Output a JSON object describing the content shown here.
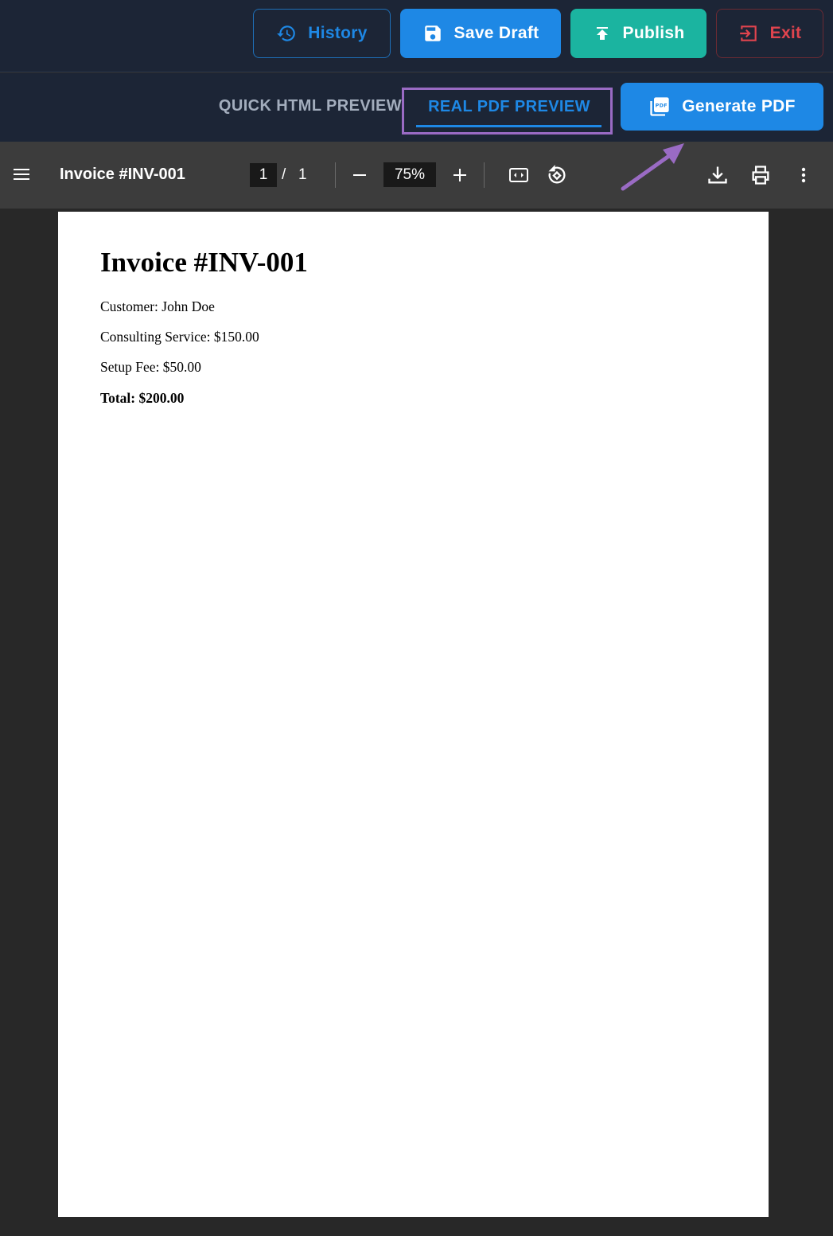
{
  "toolbar": {
    "history_label": "History",
    "save_draft_label": "Save Draft",
    "publish_label": "Publish",
    "exit_label": "Exit"
  },
  "tabs": {
    "quick_html_label": "QUICK HTML PREVIEW",
    "real_pdf_label": "REAL PDF PREVIEW",
    "active": "REAL PDF PREVIEW"
  },
  "generate_pdf_label": "Generate PDF",
  "pdf_viewer": {
    "title": "Invoice #INV-001",
    "current_page": "1",
    "page_separator": "/",
    "total_pages": "1",
    "zoom": "75%"
  },
  "document": {
    "heading": "Invoice #INV-001",
    "customer": "Customer: John Doe",
    "line1": "Consulting Service: $150.00",
    "line2": "Setup Fee: $50.00",
    "total": "Total: $200.00"
  },
  "colors": {
    "header_bg": "#1c2536",
    "accent_blue": "#1e88e5",
    "publish_teal": "#1bb4a0",
    "exit_red": "#e0444e",
    "annotation_purple": "#9a6bc4",
    "viewer_bar": "#3c3c3c",
    "viewer_bg": "#282828"
  },
  "icons": [
    "history-icon",
    "save-icon",
    "upload-icon",
    "exit-icon",
    "pdf-file-icon",
    "hamburger-menu-icon",
    "zoom-out-icon",
    "zoom-in-icon",
    "fit-page-icon",
    "rotate-icon",
    "download-icon",
    "print-icon",
    "more-vertical-icon",
    "annotation-arrow-icon"
  ]
}
